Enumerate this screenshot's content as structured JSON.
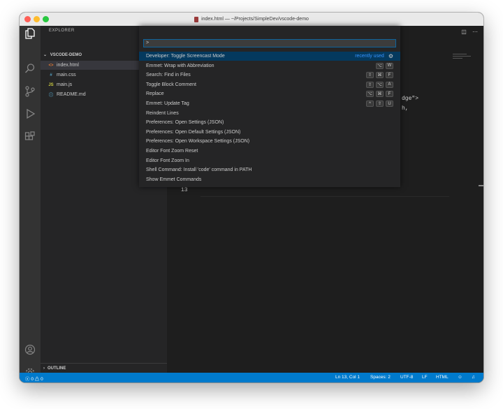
{
  "window": {
    "title": "index.html — ~/Projects/SimpleDev/vscode-demo"
  },
  "sidebar": {
    "title": "EXPLORER",
    "folder": "VSCODE-DEMO",
    "files": [
      {
        "name": "index.html",
        "icon": "html-file-icon",
        "icon_text": "<>",
        "color": "#e37933",
        "active": true
      },
      {
        "name": "main.css",
        "icon": "css-file-icon",
        "icon_text": "#",
        "color": "#519aba",
        "active": false
      },
      {
        "name": "main.js",
        "icon": "js-file-icon",
        "icon_text": "JS",
        "color": "#cbcb41",
        "active": false
      },
      {
        "name": "README.md",
        "icon": "info-file-icon",
        "icon_text": "ⓘ",
        "color": "#519aba",
        "active": false
      }
    ],
    "outline": "OUTLINE"
  },
  "palette": {
    "input_value": ">",
    "recently_used": "recently used",
    "commands": [
      {
        "label": "Developer: Toggle Screencast Mode",
        "keys": []
      },
      {
        "label": "Emmet: Wrap with Abbreviation",
        "keys": [
          "⌥",
          "W"
        ]
      },
      {
        "label": "Search: Find in Files",
        "keys": [
          "⇧",
          "⌘",
          "F"
        ]
      },
      {
        "label": "Toggle Block Comment",
        "keys": [
          "⇧",
          "⌥",
          "A"
        ]
      },
      {
        "label": "Replace",
        "keys": [
          "⌥",
          "⌘",
          "F"
        ]
      },
      {
        "label": "Emmet: Update Tag",
        "keys": [
          "^",
          "⇧",
          "U"
        ]
      },
      {
        "label": "Reindent Lines",
        "keys": []
      },
      {
        "label": "Preferences: Open Settings (JSON)",
        "keys": []
      },
      {
        "label": "Preferences: Open Default Settings (JSON)",
        "keys": []
      },
      {
        "label": "Preferences: Open Workspace Settings (JSON)",
        "keys": []
      },
      {
        "label": "Editor Font Zoom Reset",
        "keys": []
      },
      {
        "label": "Editor Font Zoom In",
        "keys": []
      },
      {
        "label": "Shell Command: Install 'code' command in PATH",
        "keys": []
      },
      {
        "label": "Show Emmet Commands",
        "keys": []
      }
    ]
  },
  "editor": {
    "line_number": "13",
    "code_fragments": [
      "dge\">",
      "h,"
    ]
  },
  "statusbar": {
    "errors": "0",
    "warnings": "0",
    "position": "Ln 13, Col 1",
    "spaces": "Spaces: 2",
    "encoding": "UTF-8",
    "eol": "LF",
    "language": "HTML"
  },
  "colors": {
    "accent": "#007acc",
    "selection": "#04395e",
    "recently_used": "#3794ff"
  }
}
